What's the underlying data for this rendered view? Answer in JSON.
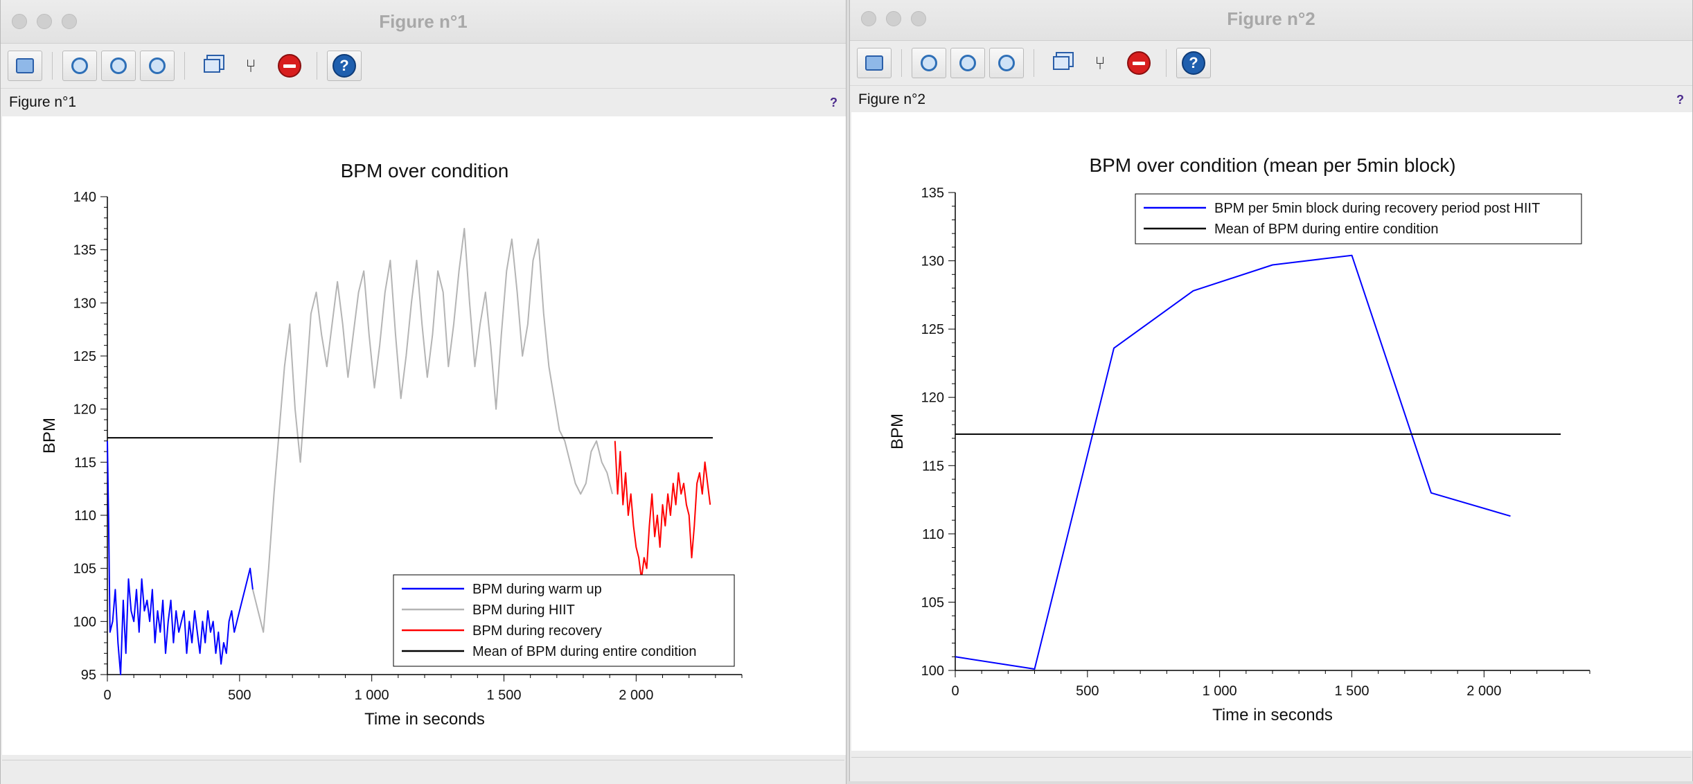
{
  "windows": [
    {
      "title": "Figure n°1",
      "subtitle": "Figure n°1",
      "help": "?",
      "chart_data": {
        "type": "line",
        "title": "BPM over condition",
        "xlabel": "Time in seconds",
        "ylabel": "BPM",
        "xlim": [
          0,
          2400
        ],
        "ylim": [
          95,
          140
        ],
        "xticks": [
          0,
          500,
          1000,
          1500,
          2000
        ],
        "xtick_labels": [
          "0",
          "500",
          "1 000",
          "1 500",
          "2 000"
        ],
        "yticks": [
          95,
          100,
          105,
          110,
          115,
          120,
          125,
          130,
          135,
          140
        ],
        "grid": false,
        "legend_position": "bottom-right",
        "series": [
          {
            "name": "BPM during warm up",
            "color": "#0000ff",
            "x": [
              0,
              5,
              10,
              20,
              30,
              40,
              50,
              60,
              70,
              80,
              90,
              100,
              110,
              120,
              130,
              140,
              150,
              160,
              170,
              180,
              190,
              200,
              210,
              220,
              230,
              240,
              250,
              260,
              270,
              280,
              290,
              300,
              310,
              320,
              330,
              340,
              350,
              360,
              370,
              380,
              390,
              400,
              410,
              420,
              430,
              440,
              450,
              460,
              470,
              480,
              490,
              500,
              510,
              520,
              530,
              540,
              550
            ],
            "y": [
              117,
              109,
              99,
              100,
              103,
              98,
              95,
              102,
              97,
              104,
              101,
              100,
              103,
              99,
              104,
              101,
              102,
              100,
              103,
              98,
              101,
              99,
              102,
              97,
              100,
              102,
              98,
              101,
              99,
              100,
              101,
              97,
              100,
              98,
              101,
              99,
              97,
              100,
              98,
              101,
              99,
              100,
              97,
              99,
              96,
              98,
              97,
              100,
              101,
              99,
              100,
              101,
              102,
              103,
              104,
              105,
              103
            ]
          },
          {
            "name": "BPM during HIIT",
            "color": "#b4b4b4",
            "x": [
              550,
              570,
              590,
              610,
              630,
              650,
              670,
              690,
              710,
              730,
              750,
              770,
              790,
              810,
              830,
              850,
              870,
              890,
              910,
              930,
              950,
              970,
              990,
              1010,
              1030,
              1050,
              1070,
              1090,
              1110,
              1130,
              1150,
              1170,
              1190,
              1210,
              1230,
              1250,
              1270,
              1290,
              1310,
              1330,
              1350,
              1370,
              1390,
              1410,
              1430,
              1450,
              1470,
              1490,
              1510,
              1530,
              1550,
              1570,
              1590,
              1610,
              1630,
              1650,
              1670,
              1690,
              1710,
              1730,
              1750,
              1770,
              1790,
              1810,
              1830,
              1850,
              1870,
              1890,
              1910
            ],
            "y": [
              103,
              101,
              99,
              105,
              112,
              118,
              124,
              128,
              120,
              115,
              122,
              129,
              131,
              127,
              124,
              128,
              132,
              128,
              123,
              127,
              131,
              133,
              127,
              122,
              126,
              131,
              134,
              127,
              121,
              125,
              130,
              134,
              128,
              123,
              127,
              133,
              131,
              124,
              128,
              133,
              137,
              130,
              124,
              128,
              131,
              126,
              120,
              127,
              133,
              136,
              131,
              125,
              128,
              134,
              136,
              129,
              124,
              121,
              118,
              117,
              115,
              113,
              112,
              113,
              116,
              117,
              115,
              114,
              112
            ]
          },
          {
            "name": "BPM during recovery",
            "color": "#ff0000",
            "x": [
              1920,
              1930,
              1940,
              1950,
              1960,
              1970,
              1980,
              1990,
              2000,
              2010,
              2020,
              2030,
              2040,
              2050,
              2060,
              2070,
              2080,
              2090,
              2100,
              2110,
              2120,
              2130,
              2140,
              2150,
              2160,
              2170,
              2180,
              2190,
              2200,
              2210,
              2220,
              2230,
              2240,
              2250,
              2260,
              2270,
              2280
            ],
            "y": [
              117,
              112,
              116,
              111,
              114,
              110,
              112,
              109,
              107,
              106,
              104,
              106,
              105,
              109,
              112,
              108,
              110,
              107,
              111,
              109,
              112,
              110,
              113,
              111,
              114,
              112,
              113,
              111,
              110,
              106,
              109,
              113,
              114,
              112,
              115,
              113,
              111
            ]
          },
          {
            "name": "Mean of BPM during entire condition",
            "color": "#000000",
            "x": [
              0,
              2290
            ],
            "y": [
              117.3,
              117.3
            ]
          }
        ]
      }
    },
    {
      "title": "Figure n°2",
      "subtitle": "Figure n°2",
      "help": "?",
      "chart_data": {
        "type": "line",
        "title": "BPM over condition (mean per 5min block)",
        "xlabel": "Time in seconds",
        "ylabel": "BPM",
        "xlim": [
          0,
          2400
        ],
        "ylim": [
          100,
          135
        ],
        "xticks": [
          0,
          500,
          1000,
          1500,
          2000
        ],
        "xtick_labels": [
          "0",
          "500",
          "1 000",
          "1 500",
          "2 000"
        ],
        "yticks": [
          100,
          105,
          110,
          115,
          120,
          125,
          130,
          135
        ],
        "grid": false,
        "legend_position": "top-right",
        "series": [
          {
            "name": "BPM per 5min block during recovery period post HIIT",
            "color": "#0000ff",
            "x": [
              0,
              300,
              600,
              900,
              1200,
              1500,
              1800,
              2100
            ],
            "y": [
              101,
              100.1,
              123.6,
              127.8,
              129.7,
              130.4,
              113,
              111.3
            ]
          },
          {
            "name": "Mean of BPM during entire condition",
            "color": "#000000",
            "x": [
              0,
              2290
            ],
            "y": [
              117.3,
              117.3
            ]
          }
        ]
      }
    }
  ]
}
